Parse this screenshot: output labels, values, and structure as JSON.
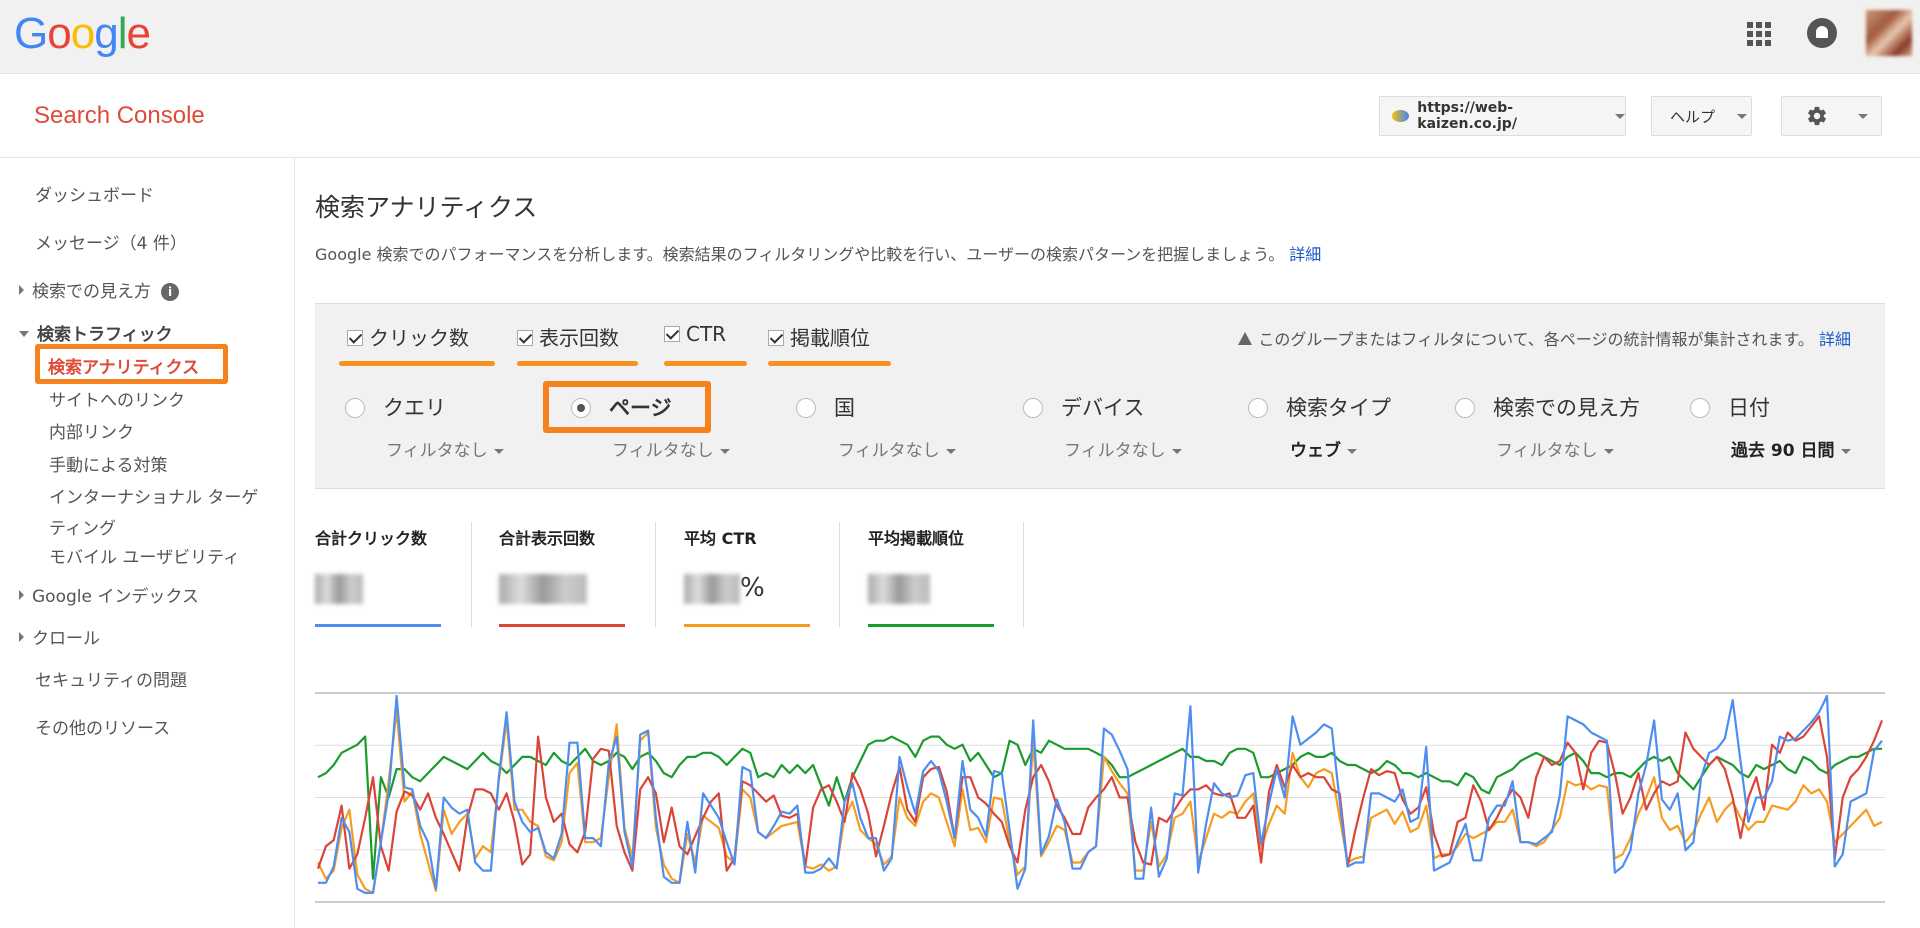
{
  "brand": {
    "google_letters": [
      "G",
      "o",
      "o",
      "g",
      "l",
      "e"
    ],
    "google_colors": [
      "#4285f4",
      "#ea4335",
      "#fbbc05",
      "#4285f4",
      "#34a853",
      "#ea4335"
    ]
  },
  "app": {
    "title": "Search Console"
  },
  "header": {
    "site": "https://web-kaizen.co.jp/",
    "help": "ヘルプ"
  },
  "sidebar": {
    "dashboard": "ダッシュボード",
    "messages": "メッセージ（4 件）",
    "search_appearance": "検索での見え方",
    "search_traffic": "検索トラフィック",
    "search_analytics": "検索アナリティクス",
    "links_to_site": "サイトへのリンク",
    "internal_links": "内部リンク",
    "manual_actions": "手動による対策",
    "intl_targeting_1": "インターナショナル ターゲ",
    "intl_targeting_2": "ティング",
    "mobile_usability": "モバイル ユーザビリティ",
    "google_index": "Google インデックス",
    "crawl": "クロール",
    "security": "セキュリティの問題",
    "other_resources": "その他のリソース"
  },
  "main": {
    "title": "検索アナリティクス",
    "description": "Google 検索でのパフォーマンスを分析します。検索結果のフィルタリングや比較を行い、ユーザーの検索パターンを把握しましょう。",
    "details_link": "詳細"
  },
  "metrics": {
    "clicks": "クリック数",
    "impressions": "表示回数",
    "ctr": "CTR",
    "position": "掲載順位"
  },
  "notice": {
    "text": "このグループまたはフィルタについて、各ページの統計情報が集計されます。",
    "link": "詳細"
  },
  "dimensions": {
    "query": {
      "label": "クエリ",
      "filter": "フィルタなし"
    },
    "page": {
      "label": "ページ",
      "filter": "フィルタなし"
    },
    "country": {
      "label": "国",
      "filter": "フィルタなし"
    },
    "device": {
      "label": "デバイス",
      "filter": "フィルタなし"
    },
    "search_type": {
      "label": "検索タイプ",
      "filter": "ウェブ"
    },
    "appearance": {
      "label": "検索での見え方",
      "filter": "フィルタなし"
    },
    "date": {
      "label": "日付",
      "filter": "過去 90 日間"
    }
  },
  "stats": {
    "total_clicks": "合計クリック数",
    "total_impressions": "合計表示回数",
    "avg_ctr": "平均 CTR",
    "ctr_unit": "%",
    "avg_position": "平均掲載順位"
  },
  "colors": {
    "clicks": "#4d8ef0",
    "impressions": "#db4437",
    "ctr": "#f79d1e",
    "position": "#1a9b2c",
    "highlight": "#f5821f"
  },
  "chart_data": {
    "type": "line",
    "ylim": [
      0,
      100
    ],
    "series": [
      {
        "name": "クリック数",
        "values": [
          8,
          8,
          16,
          40,
          33,
          5,
          3,
          3,
          28,
          52,
          100,
          55,
          54,
          36,
          28,
          5,
          50,
          45,
          42,
          44,
          18,
          14,
          14,
          60,
          92,
          48,
          38,
          33,
          35,
          23,
          20,
          32,
          77,
          77,
          30,
          30,
          26,
          67,
          80,
          33,
          16,
          81,
          83,
          40,
          11,
          8,
          8,
          38,
          13,
          52,
          46,
          40,
          28,
          17,
          65,
          63,
          33,
          30,
          36,
          43,
          42,
          46,
          13,
          13,
          15,
          20,
          15,
          48,
          57,
          40,
          30,
          30,
          14,
          20,
          70,
          55,
          42,
          63,
          68,
          63,
          48,
          30,
          68,
          44,
          40,
          31,
          63,
          62,
          34,
          5,
          15,
          88,
          22,
          31,
          49,
          38,
          15,
          15,
          23,
          26,
          84,
          81,
          73,
          64,
          10,
          10,
          45,
          11,
          20,
          52,
          51,
          95,
          13,
          37,
          57,
          52,
          50,
          51,
          61,
          62,
          27,
          47,
          64,
          50,
          90,
          76,
          79,
          82,
          86,
          84,
          48,
          16,
          18,
          18,
          52,
          52,
          50,
          48,
          54,
          38,
          40,
          75,
          14,
          16,
          18,
          28,
          37,
          19,
          19,
          40,
          46,
          46,
          58,
          28,
          28,
          27,
          30,
          33,
          51,
          90,
          88,
          86,
          82,
          80,
          78,
          13,
          16,
          24,
          52,
          66,
          88,
          49,
          44,
          52,
          24,
          28,
          60,
          72,
          74,
          79,
          98,
          68,
          38,
          50,
          50,
          58,
          80,
          78,
          79,
          83,
          87,
          92,
          100,
          16,
          22,
          48,
          50,
          52,
          73,
          78
        ],
        "color": "#4d8ef0"
      },
      {
        "name": "表示回数",
        "values": [
          15,
          26,
          29,
          46,
          15,
          22,
          40,
          60,
          26,
          14,
          43,
          53,
          51,
          44,
          52,
          40,
          32,
          23,
          14,
          40,
          54,
          54,
          52,
          44,
          52,
          38,
          17,
          22,
          80,
          50,
          38,
          42,
          27,
          23,
          33,
          69,
          74,
          73,
          36,
          23,
          14,
          54,
          60,
          52,
          28,
          45,
          26,
          22,
          31,
          40,
          48,
          52,
          14,
          20,
          58,
          56,
          52,
          48,
          51,
          41,
          40,
          42,
          16,
          45,
          54,
          56,
          48,
          38,
          62,
          54,
          42,
          21,
          36,
          52,
          65,
          44,
          38,
          60,
          64,
          65,
          53,
          30,
          60,
          60,
          50,
          47,
          42,
          38,
          26,
          18,
          44,
          60,
          66,
          58,
          46,
          40,
          32,
          32,
          45,
          50,
          54,
          60,
          50,
          50,
          28,
          18,
          17,
          40,
          38,
          44,
          50,
          54,
          54,
          56,
          52,
          51,
          52,
          40,
          40,
          46,
          18,
          53,
          66,
          55,
          66,
          60,
          62,
          60,
          60,
          54,
          52,
          16,
          34,
          50,
          64,
          61,
          63,
          62,
          49,
          42,
          45,
          55,
          32,
          21,
          22,
          38,
          40,
          56,
          48,
          34,
          40,
          48,
          54,
          50,
          40,
          60,
          70,
          66,
          68,
          77,
          72,
          54,
          72,
          78,
          77,
          62,
          42,
          50,
          62,
          44,
          52,
          58,
          56,
          58,
          82,
          74,
          70,
          66,
          70,
          64,
          50,
          30,
          50,
          60,
          44,
          76,
          72,
          82,
          78,
          80,
          85,
          90,
          70,
          20,
          50,
          60,
          64,
          70,
          78,
          88
        ],
        "color": "#db4437"
      },
      {
        "name": "CTR",
        "values": [
          18,
          10,
          14,
          35,
          44,
          12,
          5,
          3,
          28,
          58,
          93,
          48,
          53,
          32,
          18,
          4,
          44,
          32,
          38,
          42,
          20,
          26,
          23,
          58,
          88,
          44,
          44,
          38,
          36,
          21,
          19,
          28,
          62,
          67,
          28,
          28,
          30,
          60,
          86,
          35,
          20,
          78,
          82,
          35,
          17,
          10,
          8,
          32,
          18,
          41,
          38,
          35,
          21,
          18,
          54,
          50,
          33,
          30,
          33,
          36,
          37,
          38,
          16,
          15,
          17,
          14,
          16,
          40,
          48,
          34,
          30,
          27,
          17,
          21,
          50,
          40,
          36,
          48,
          52,
          50,
          38,
          26,
          54,
          34,
          35,
          28,
          50,
          49,
          28,
          12,
          16,
          78,
          21,
          28,
          36,
          34,
          18,
          18,
          23,
          26,
          70,
          63,
          57,
          52,
          14,
          14,
          38,
          16,
          22,
          40,
          42,
          48,
          18,
          30,
          42,
          40,
          43,
          42,
          48,
          52,
          25,
          37,
          46,
          42,
          72,
          60,
          55,
          62,
          64,
          62,
          40,
          18,
          20,
          21,
          40,
          42,
          44,
          37,
          43,
          33,
          35,
          46,
          20,
          22,
          22,
          26,
          32,
          30,
          32,
          34,
          38,
          38,
          44,
          28,
          28,
          26,
          28,
          34,
          40,
          58,
          56,
          57,
          54,
          56,
          55,
          20,
          22,
          30,
          42,
          50,
          60,
          40,
          34,
          36,
          28,
          33,
          42,
          50,
          38,
          44,
          48,
          40,
          34,
          38,
          38,
          46,
          45,
          44,
          48,
          56,
          52,
          54,
          48,
          28,
          32,
          36,
          40,
          44,
          36,
          38
        ],
        "color": "#f79d1e"
      },
      {
        "name": "掲載順位",
        "values": [
          60,
          62,
          66,
          72,
          74,
          76,
          80,
          10,
          60,
          50,
          64,
          64,
          60,
          58,
          62,
          66,
          70,
          68,
          66,
          64,
          68,
          72,
          68,
          66,
          62,
          66,
          70,
          70,
          68,
          66,
          72,
          68,
          66,
          70,
          74,
          68,
          66,
          68,
          72,
          70,
          64,
          70,
          72,
          68,
          62,
          60,
          66,
          70,
          70,
          72,
          72,
          70,
          66,
          70,
          74,
          72,
          60,
          62,
          60,
          66,
          62,
          66,
          62,
          66,
          56,
          46,
          60,
          48,
          60,
          68,
          76,
          78,
          78,
          80,
          78,
          76,
          70,
          78,
          80,
          80,
          76,
          74,
          76,
          68,
          72,
          66,
          60,
          62,
          78,
          76,
          66,
          74,
          72,
          78,
          76,
          74,
          74,
          74,
          74,
          72,
          70,
          66,
          60,
          60,
          62,
          64,
          66,
          68,
          70,
          72,
          74,
          70,
          70,
          68,
          68,
          66,
          72,
          74,
          74,
          72,
          60,
          60,
          62,
          64,
          66,
          70,
          72,
          70,
          70,
          72,
          68,
          66,
          66,
          64,
          62,
          64,
          68,
          66,
          62,
          62,
          60,
          62,
          60,
          58,
          58,
          56,
          62,
          60,
          54,
          52,
          60,
          62,
          64,
          68,
          70,
          72,
          70,
          68,
          66,
          70,
          72,
          68,
          62,
          62,
          60,
          62,
          62,
          60,
          64,
          68,
          70,
          68,
          70,
          62,
          58,
          54,
          60,
          66,
          70,
          68,
          66,
          62,
          60,
          66,
          64,
          66,
          68,
          64,
          62,
          70,
          68,
          64,
          62,
          66,
          68,
          70,
          70,
          72,
          74,
          74
        ],
        "color": "#1a9b2c"
      }
    ]
  }
}
